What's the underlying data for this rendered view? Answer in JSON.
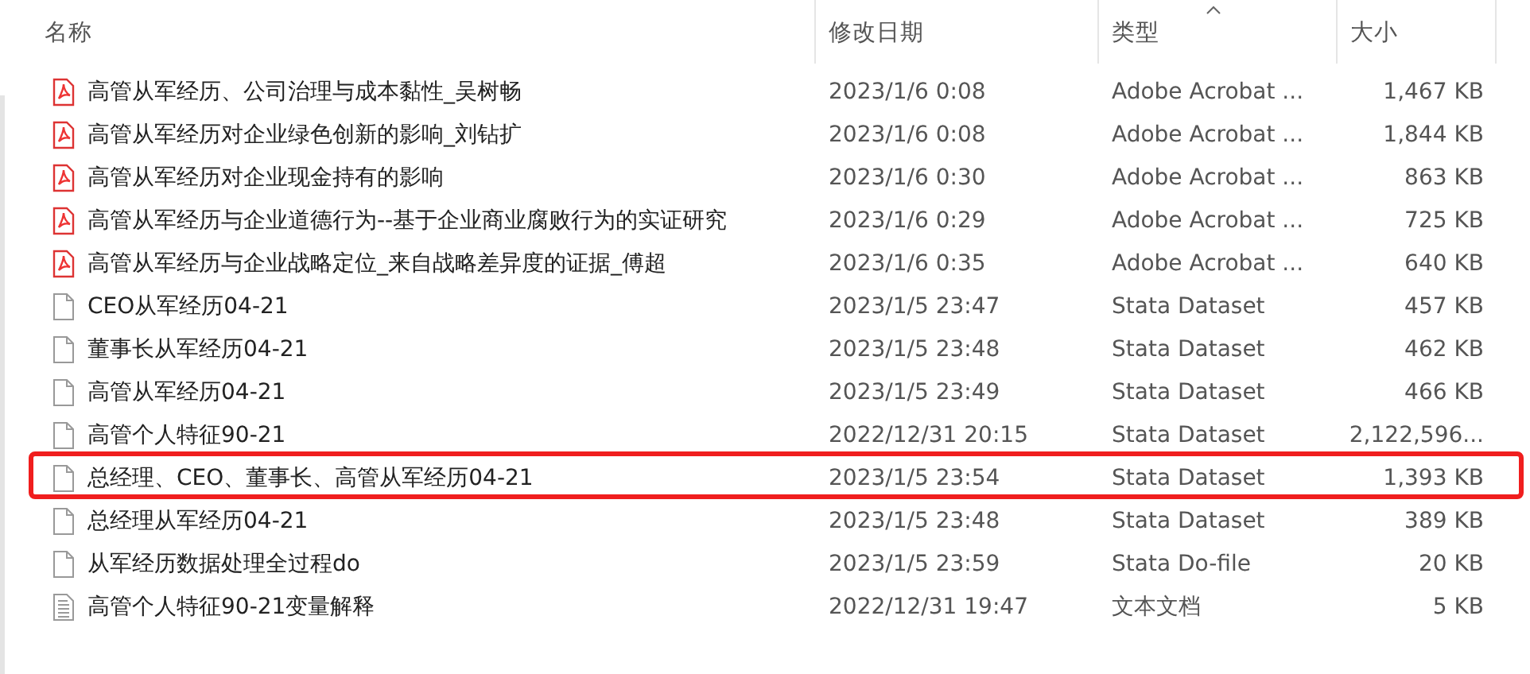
{
  "columns": [
    {
      "label": "名称",
      "sorted": false
    },
    {
      "label": "修改日期",
      "sorted": false
    },
    {
      "label": "类型",
      "sorted": true
    },
    {
      "label": "大小",
      "sorted": false
    }
  ],
  "rows": [
    {
      "kind": "pdf",
      "name": "高管从军经历、公司治理与成本黏性_吴树畅",
      "date": "2023/1/6 0:08",
      "type": "Adobe Acrobat ...",
      "size": "1,467 KB",
      "annotated": false
    },
    {
      "kind": "pdf",
      "name": "高管从军经历对企业绿色创新的影响_刘钻扩",
      "date": "2023/1/6 0:08",
      "type": "Adobe Acrobat ...",
      "size": "1,844 KB",
      "annotated": false
    },
    {
      "kind": "pdf",
      "name": "高管从军经历对企业现金持有的影响",
      "date": "2023/1/6 0:30",
      "type": "Adobe Acrobat ...",
      "size": "863 KB",
      "annotated": false
    },
    {
      "kind": "pdf",
      "name": "高管从军经历与企业道德行为--基于企业商业腐败行为的实证研究",
      "date": "2023/1/6 0:29",
      "type": "Adobe Acrobat ...",
      "size": "725 KB",
      "annotated": false
    },
    {
      "kind": "pdf",
      "name": "高管从军经历与企业战略定位_来自战略差异度的证据_傅超",
      "date": "2023/1/6 0:35",
      "type": "Adobe Acrobat ...",
      "size": "640 KB",
      "annotated": false
    },
    {
      "kind": "blank",
      "name": "CEO从军经历04-21",
      "date": "2023/1/5 23:47",
      "type": "Stata Dataset",
      "size": "457 KB",
      "annotated": false
    },
    {
      "kind": "blank",
      "name": "董事长从军经历04-21",
      "date": "2023/1/5 23:48",
      "type": "Stata Dataset",
      "size": "462 KB",
      "annotated": false
    },
    {
      "kind": "blank",
      "name": "高管从军经历04-21",
      "date": "2023/1/5 23:49",
      "type": "Stata Dataset",
      "size": "466 KB",
      "annotated": false
    },
    {
      "kind": "blank",
      "name": "高管个人特征90-21",
      "date": "2022/12/31 20:15",
      "type": "Stata Dataset",
      "size": "2,122,596...",
      "annotated": false
    },
    {
      "kind": "blank",
      "name": "总经理、CEO、董事长、高管从军经历04-21",
      "date": "2023/1/5 23:54",
      "type": "Stata Dataset",
      "size": "1,393 KB",
      "annotated": true
    },
    {
      "kind": "blank",
      "name": "总经理从军经历04-21",
      "date": "2023/1/5 23:48",
      "type": "Stata Dataset",
      "size": "389 KB",
      "annotated": false
    },
    {
      "kind": "blank",
      "name": "从军经历数据处理全过程do",
      "date": "2023/1/5 23:59",
      "type": "Stata Do-file",
      "size": "20 KB",
      "annotated": false
    },
    {
      "kind": "text",
      "name": "高管个人特征90-21变量解释",
      "date": "2022/12/31 19:47",
      "type": "文本文档",
      "size": "5 KB",
      "annotated": false
    }
  ]
}
